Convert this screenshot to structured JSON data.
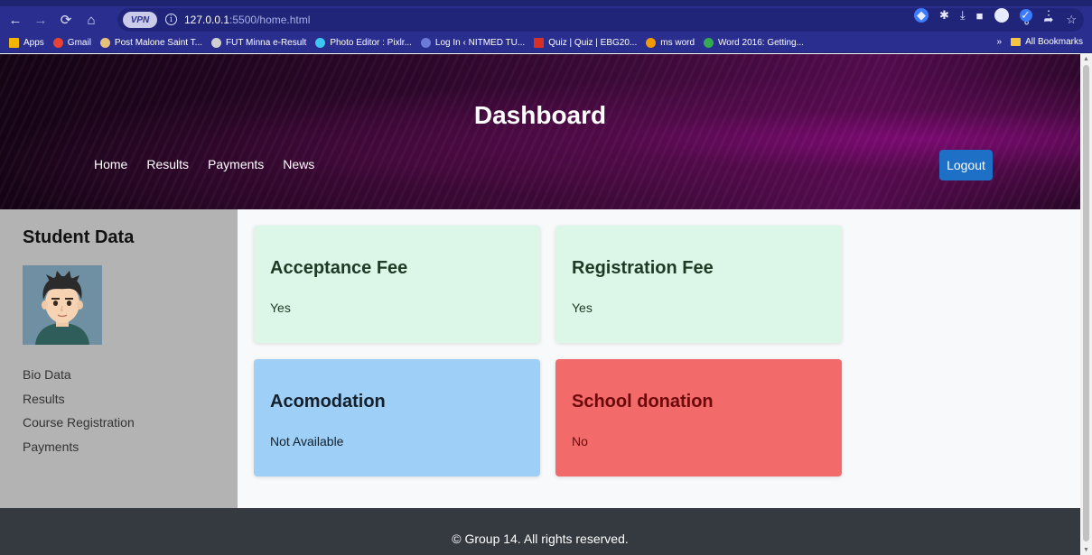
{
  "browser": {
    "url_host": "127.0.0.1",
    "url_rest": ":5500/home.html",
    "vpn_label": "VPN",
    "bookmarks": [
      {
        "label": "Apps",
        "color": "#f4b400"
      },
      {
        "label": "Gmail",
        "color": "#ea4335"
      },
      {
        "label": "Post Malone Saint T...",
        "color": "#e6c27a"
      },
      {
        "label": "FUT Minna e-Result",
        "color": "#d0d0d0"
      },
      {
        "label": "Photo Editor : Pixlr...",
        "color": "#3cc8f0"
      },
      {
        "label": "Log In ‹ NITMED TU...",
        "color": "#6b7bd6"
      },
      {
        "label": "Quiz | Quiz | EBG20...",
        "color": "#d93025"
      },
      {
        "label": "ms word",
        "color": "#f29900"
      },
      {
        "label": "Word 2016: Getting...",
        "color": "#34a853"
      }
    ],
    "more_label": "»",
    "all_bookmarks": "All Bookmarks"
  },
  "header": {
    "title": "Dashboard",
    "nav": [
      "Home",
      "Results",
      "Payments",
      "News"
    ],
    "logout_label": "Logout"
  },
  "sidebar": {
    "title": "Student Data",
    "links": [
      "Bio Data",
      "Results",
      "Course Registration",
      "Payments"
    ]
  },
  "cards": [
    {
      "title": "Acceptance Fee",
      "value": "Yes",
      "color": "#dcf7e8"
    },
    {
      "title": "Registration Fee",
      "value": "Yes",
      "color": "#dcf7e8"
    },
    {
      "title": "Acomodation",
      "value": "Not Available",
      "color": "#9ecff6"
    },
    {
      "title": "School donation",
      "value": "No",
      "color": "#f26a6a"
    }
  ],
  "footer": {
    "text": "© Group 14. All rights reserved."
  },
  "colors": {
    "logout": "#1e6fc6",
    "sidebar": "#b3b3b3",
    "footer": "#343a40"
  }
}
